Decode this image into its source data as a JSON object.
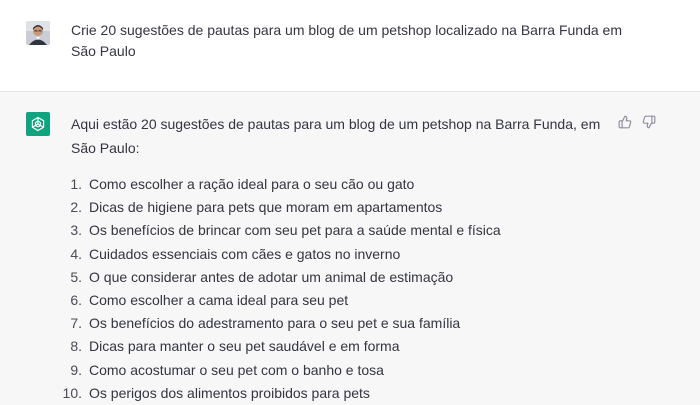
{
  "user_message": {
    "text": "Crie 20 sugestões de pautas para um blog de um petshop localizado na Barra Funda em São Paulo"
  },
  "assistant_message": {
    "intro": "Aqui estão 20 sugestões de pautas para um blog de um petshop na Barra Funda, em São Paulo:",
    "items": [
      {
        "num": "1.",
        "text": "Como escolher a ração ideal para o seu cão ou gato"
      },
      {
        "num": "2.",
        "text": "Dicas de higiene para pets que moram em apartamentos"
      },
      {
        "num": "3.",
        "text": "Os benefícios de brincar com seu pet para a saúde mental e física"
      },
      {
        "num": "4.",
        "text": "Cuidados essenciais com cães e gatos no inverno"
      },
      {
        "num": "5.",
        "text": "O que considerar antes de adotar um animal de estimação"
      },
      {
        "num": "6.",
        "text": "Como escolher a cama ideal para seu pet"
      },
      {
        "num": "7.",
        "text": "Os benefícios do adestramento para o seu pet e sua família"
      },
      {
        "num": "8.",
        "text": "Dicas para manter o seu pet saudável e em forma"
      },
      {
        "num": "9.",
        "text": "Como acostumar o seu pet com o banho e tosa"
      },
      {
        "num": "10.",
        "text": "Os perigos dos alimentos proibidos para pets"
      }
    ]
  },
  "icons": {
    "user_avatar": "user-avatar-photo",
    "assistant_avatar": "openai-logo-icon",
    "feedback_up": "thumbs-up-icon",
    "feedback_down": "thumbs-down-icon"
  },
  "colors": {
    "assistant_accent": "#10a37f",
    "assistant_bg": "#f7f7f8",
    "text": "#343541"
  }
}
